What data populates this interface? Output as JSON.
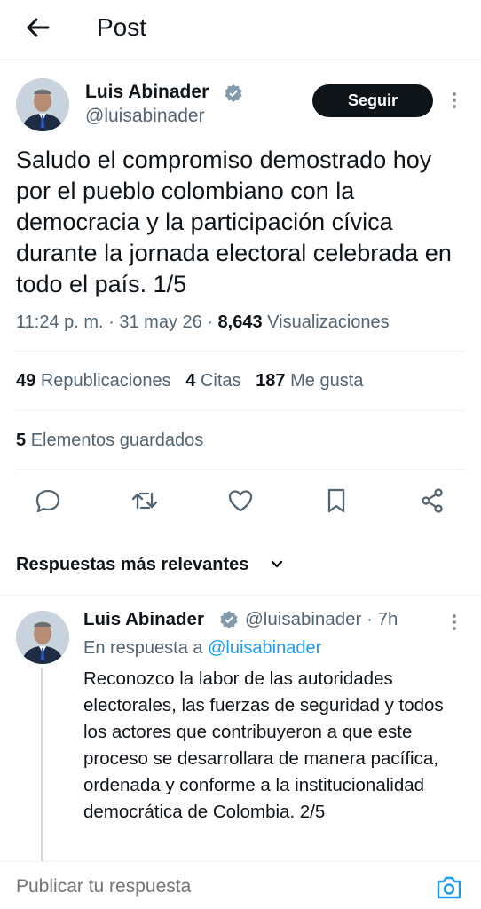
{
  "header": {
    "title": "Post"
  },
  "post": {
    "author_name": "Luis Abinader",
    "author_handle": "@luisabinader",
    "follow_label": "Seguir",
    "text": "Saludo el compromiso demostrado hoy por el pueblo colombiano con la democracia y la participación cívica durante la jornada electoral celebrada en todo el país. 1/5",
    "time": "11:24 p. m.",
    "date": "31 may 26",
    "views_count": "8,643",
    "views_label": "Visualizaciones",
    "reposts_count": "49",
    "reposts_label": "Republicaciones",
    "quotes_count": "4",
    "quotes_label": "Citas",
    "likes_count": "187",
    "likes_label": "Me gusta",
    "bookmarks_count": "5",
    "bookmarks_label": "Elementos guardados"
  },
  "actions": [
    "reply-icon",
    "repost-icon",
    "like-icon",
    "bookmark-icon",
    "share-icon"
  ],
  "replies_sort": {
    "label": "Respuestas más relevantes"
  },
  "reply": {
    "author_name": "Luis Abinader",
    "author_handle": "@luisabinader",
    "separator": "·",
    "time_ago": "7h",
    "in_reply_prefix": "En respuesta a",
    "in_reply_handle": "@luisabinader",
    "text": "Reconozco la labor de las autoridades electorales, las fuerzas de seguridad y todos los actores que contribuyeron a que este proceso se desarrollara de manera pacífica, ordenada y conforme a la institucionalidad democrática de Colombia. 2/5"
  },
  "composer": {
    "placeholder": "Publicar tu respuesta"
  },
  "colors": {
    "accent": "#1d9bf0",
    "muted": "#536471",
    "text": "#0f1419",
    "border": "#eff3f4"
  }
}
